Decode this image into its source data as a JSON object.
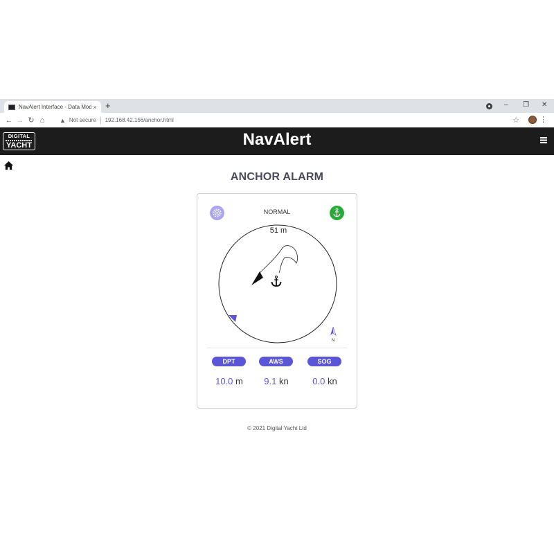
{
  "browser": {
    "tab_title": "NavAlert Interface - Data Modes",
    "tab_close": "×",
    "new_tab": "+",
    "security_text": "Not secure",
    "url": "192.168.42.156/anchor.html",
    "window_controls": [
      "–",
      "❐",
      "✕"
    ]
  },
  "header": {
    "logo_top": "DIGITAL",
    "logo_bottom": "YACHT",
    "title": "NavAlert"
  },
  "page": {
    "heading": "ANCHOR ALARM"
  },
  "anchor": {
    "status": "NORMAL",
    "radius_label": "51 m",
    "north_label": "N",
    "colors": {
      "accent": "#5b56d8",
      "ok": "#2aaa3a",
      "settings": "#a9a6ef"
    }
  },
  "readings": [
    {
      "label": "DPT",
      "value": "10.0",
      "unit": "m"
    },
    {
      "label": "AWS",
      "value": "9.1",
      "unit": "kn"
    },
    {
      "label": "SOG",
      "value": "0.0",
      "unit": "kn"
    }
  ],
  "footer": {
    "copyright": "© 2021 Digital Yacht Ltd"
  }
}
